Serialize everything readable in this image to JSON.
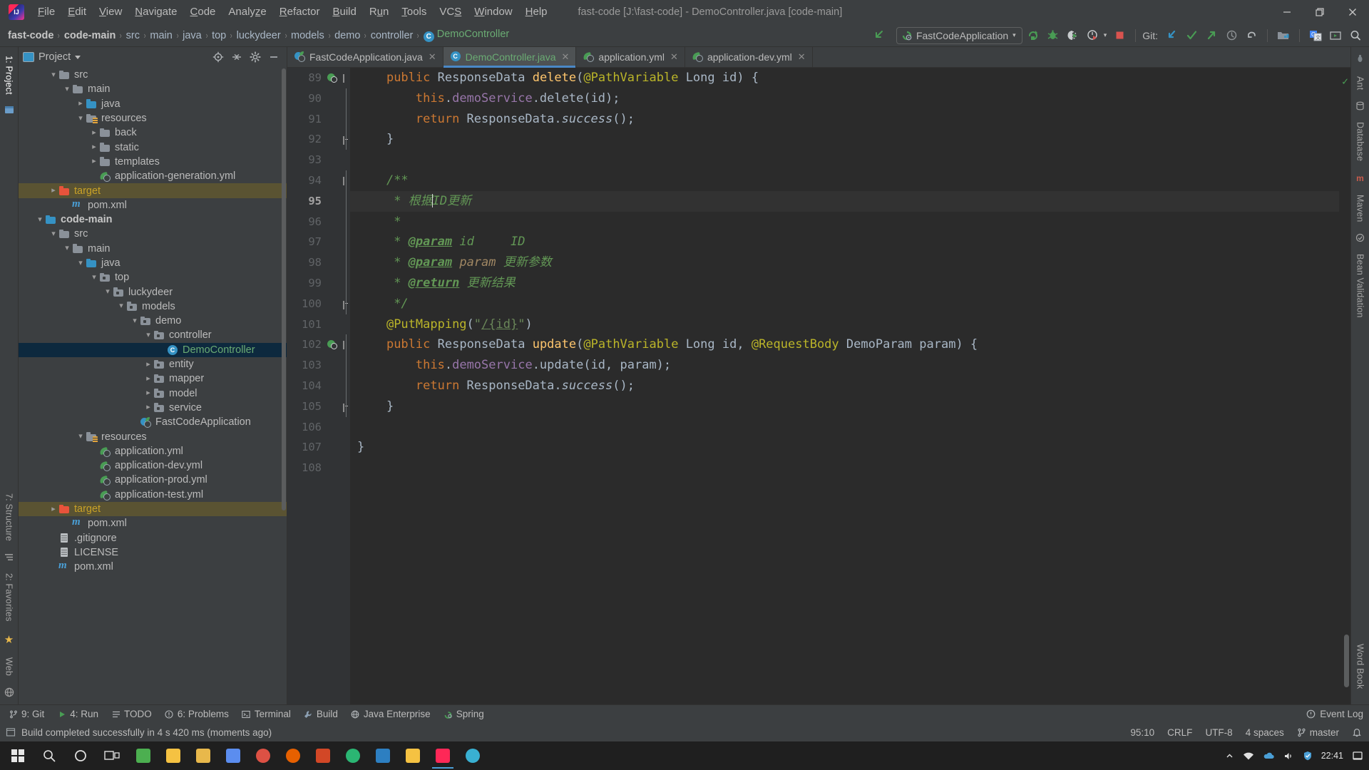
{
  "window": {
    "title": "fast-code [J:\\fast-code] - DemoController.java [code-main]",
    "minimize_label": "—",
    "maximize_label": "❐",
    "close_label": "✕"
  },
  "menubar": {
    "items": [
      {
        "label": "File",
        "mnemonic": "F"
      },
      {
        "label": "Edit",
        "mnemonic": "E"
      },
      {
        "label": "View",
        "mnemonic": "V"
      },
      {
        "label": "Navigate",
        "mnemonic": "N"
      },
      {
        "label": "Code",
        "mnemonic": "C"
      },
      {
        "label": "Analyze",
        "mnemonic": "z"
      },
      {
        "label": "Refactor",
        "mnemonic": "R"
      },
      {
        "label": "Build",
        "mnemonic": "B"
      },
      {
        "label": "Run",
        "mnemonic": "u"
      },
      {
        "label": "Tools",
        "mnemonic": "T"
      },
      {
        "label": "VCS",
        "mnemonic": "S"
      },
      {
        "label": "Window",
        "mnemonic": "W"
      },
      {
        "label": "Help",
        "mnemonic": "H"
      }
    ]
  },
  "breadcrumbs": {
    "items": [
      "fast-code",
      "code-main",
      "src",
      "main",
      "java",
      "top",
      "luckydeer",
      "models",
      "demo",
      "controller"
    ],
    "class_name": "DemoController",
    "class_icon_letter": "C",
    "separator": "›"
  },
  "toolbar": {
    "back_icon": "back-arrow-icon",
    "run_configuration": "FastCodeApplication",
    "run_config_caret": "▾",
    "run_icon": "run-icon",
    "debug_icon": "debug-icon",
    "run_coverage_icon": "run-with-coverage-icon",
    "profiler_icon": "profiler-icon",
    "profiler_caret": "▾",
    "stop_icon": "stop-icon",
    "git_label": "Git:",
    "update_project_icon": "update-project-icon",
    "commit_icon": "commit-icon",
    "push_icon": "push-icon",
    "history_icon": "history-icon",
    "rollback_icon": "rollback-icon",
    "project_structure_icon": "project-structure-icon",
    "translate_icon": "translate-icon",
    "presentation_icon": "presentation-icon",
    "search_everywhere_icon": "search-icon"
  },
  "left_strip": {
    "project_tab": "1: Project",
    "structure_tab": "7: Structure",
    "favorites_tab": "2: Favorites",
    "web_tab": "Web",
    "bottom_icons": [
      "bookmark-star-icon",
      "web-icon"
    ]
  },
  "right_strip": {
    "tabs": [
      "Ant",
      "Database",
      "Maven",
      "Bean Validation",
      "Word Book"
    ]
  },
  "project_panel": {
    "title": "Project",
    "title_caret": "▾",
    "locate_icon": "locate-in-tree-icon",
    "collapse_icon": "collapse-all-icon",
    "settings_icon": "gear-icon",
    "hide_icon": "hide-panel-icon",
    "tree": [
      {
        "label": "src",
        "indent": 2,
        "arrow": "down",
        "icon": "folder",
        "style": ""
      },
      {
        "label": "main",
        "indent": 3,
        "arrow": "down",
        "icon": "folder",
        "style": ""
      },
      {
        "label": "java",
        "indent": 4,
        "arrow": "right",
        "icon": "folder-src",
        "style": ""
      },
      {
        "label": "resources",
        "indent": 4,
        "arrow": "down",
        "icon": "folder-res",
        "style": ""
      },
      {
        "label": "back",
        "indent": 5,
        "arrow": "right",
        "icon": "folder",
        "style": ""
      },
      {
        "label": "static",
        "indent": 5,
        "arrow": "right",
        "icon": "folder",
        "style": ""
      },
      {
        "label": "templates",
        "indent": 5,
        "arrow": "right",
        "icon": "folder",
        "style": ""
      },
      {
        "label": "application-generation.yml",
        "indent": 5,
        "arrow": "none",
        "icon": "yml",
        "style": ""
      },
      {
        "label": "target",
        "indent": 2,
        "arrow": "right",
        "icon": "folder-orange",
        "style": "target"
      },
      {
        "label": "pom.xml",
        "indent": 3,
        "arrow": "none",
        "icon": "maven",
        "style": ""
      },
      {
        "label": "code-main",
        "indent": 1,
        "arrow": "down",
        "icon": "folder-src",
        "style": "bold"
      },
      {
        "label": "src",
        "indent": 2,
        "arrow": "down",
        "icon": "folder",
        "style": ""
      },
      {
        "label": "main",
        "indent": 3,
        "arrow": "down",
        "icon": "folder",
        "style": ""
      },
      {
        "label": "java",
        "indent": 4,
        "arrow": "down",
        "icon": "folder-src",
        "style": ""
      },
      {
        "label": "top",
        "indent": 5,
        "arrow": "down",
        "icon": "folder-pkg",
        "style": ""
      },
      {
        "label": "luckydeer",
        "indent": 6,
        "arrow": "down",
        "icon": "folder-pkg",
        "style": ""
      },
      {
        "label": "models",
        "indent": 7,
        "arrow": "down",
        "icon": "folder-pkg",
        "style": ""
      },
      {
        "label": "demo",
        "indent": 8,
        "arrow": "down",
        "icon": "folder-pkg",
        "style": ""
      },
      {
        "label": "controller",
        "indent": 9,
        "arrow": "down",
        "icon": "folder-pkg",
        "style": ""
      },
      {
        "label": "DemoController",
        "indent": 10,
        "arrow": "none",
        "icon": "class",
        "style": "selected"
      },
      {
        "label": "entity",
        "indent": 9,
        "arrow": "right",
        "icon": "folder-pkg",
        "style": ""
      },
      {
        "label": "mapper",
        "indent": 9,
        "arrow": "right",
        "icon": "folder-pkg",
        "style": ""
      },
      {
        "label": "model",
        "indent": 9,
        "arrow": "right",
        "icon": "folder-pkg",
        "style": ""
      },
      {
        "label": "service",
        "indent": 9,
        "arrow": "right",
        "icon": "folder-pkg",
        "style": ""
      },
      {
        "label": "FastCodeApplication",
        "indent": 8,
        "arrow": "none",
        "icon": "spring",
        "style": ""
      },
      {
        "label": "resources",
        "indent": 4,
        "arrow": "down",
        "icon": "folder-res",
        "style": ""
      },
      {
        "label": "application.yml",
        "indent": 5,
        "arrow": "none",
        "icon": "yml",
        "style": ""
      },
      {
        "label": "application-dev.yml",
        "indent": 5,
        "arrow": "none",
        "icon": "yml",
        "style": ""
      },
      {
        "label": "application-prod.yml",
        "indent": 5,
        "arrow": "none",
        "icon": "yml",
        "style": ""
      },
      {
        "label": "application-test.yml",
        "indent": 5,
        "arrow": "none",
        "icon": "yml",
        "style": ""
      },
      {
        "label": "target",
        "indent": 2,
        "arrow": "right",
        "icon": "folder-orange",
        "style": "target"
      },
      {
        "label": "pom.xml",
        "indent": 3,
        "arrow": "none",
        "icon": "maven",
        "style": ""
      },
      {
        "label": ".gitignore",
        "indent": 2,
        "arrow": "none",
        "icon": "file",
        "style": ""
      },
      {
        "label": "LICENSE",
        "indent": 2,
        "arrow": "none",
        "icon": "file",
        "style": ""
      },
      {
        "label": "pom.xml",
        "indent": 2,
        "arrow": "none",
        "icon": "maven",
        "style": ""
      }
    ]
  },
  "editor_tabs": [
    {
      "label": "FastCodeApplication.java",
      "icon": "spring-class-icon",
      "active": false,
      "close": "✕"
    },
    {
      "label": "DemoController.java",
      "icon": "class-icon",
      "active": true,
      "close": "✕"
    },
    {
      "label": "application.yml",
      "icon": "yml-icon",
      "active": false,
      "close": "✕"
    },
    {
      "label": "application-dev.yml",
      "icon": "yml-icon",
      "active": false,
      "close": "✕"
    }
  ],
  "editor": {
    "first_line_number": 89,
    "current_line": 95,
    "inspection_status": "ok-check-icon",
    "lines": [
      {
        "n": 89,
        "gutter": "run",
        "fold": "end-open",
        "html": "    <span class='kw'>public</span> <span class='type'>ResponseData</span> <span class='fn'>delete</span>(<span class='ann'>@PathVariable</span> <span class='type'>Long</span> id) {"
      },
      {
        "n": 90,
        "gutter": "",
        "fold": "line",
        "html": "        <span class='kw'>this</span>.<span class='fld'>demoService</span>.delete(id);"
      },
      {
        "n": 91,
        "gutter": "",
        "fold": "line",
        "html": "        <span class='kw'>return</span> ResponseData.<span class='italic'>success</span>();"
      },
      {
        "n": 92,
        "gutter": "",
        "fold": "end",
        "html": "    }"
      },
      {
        "n": 93,
        "gutter": "",
        "fold": "",
        "html": ""
      },
      {
        "n": 94,
        "gutter": "",
        "fold": "start",
        "html": "    <span class='cmt'>/**</span>"
      },
      {
        "n": 95,
        "gutter": "",
        "fold": "line",
        "html": "     <span class='cmt'>* 根据</span><span class='caret'></span><span class='cmt'>ID更新</span>",
        "highlight": true
      },
      {
        "n": 96,
        "gutter": "",
        "fold": "line",
        "html": "     <span class='cmt'>*</span>"
      },
      {
        "n": 97,
        "gutter": "",
        "fold": "line",
        "html": "     <span class='cmt'>* </span><span class='cmt-tag'>@param</span><span class='cmt'> id     ID</span>"
      },
      {
        "n": 98,
        "gutter": "",
        "fold": "line",
        "html": "     <span class='cmt'>* </span><span class='cmt-tag'>@param</span> <span class='cmt-pname'>param</span><span class='cmt'> 更新参数</span>"
      },
      {
        "n": 99,
        "gutter": "",
        "fold": "line",
        "html": "     <span class='cmt'>* </span><span class='cmt-tag'>@return</span><span class='cmt'> 更新结果</span>"
      },
      {
        "n": 100,
        "gutter": "",
        "fold": "end",
        "html": "     <span class='cmt'>*/</span>"
      },
      {
        "n": 101,
        "gutter": "",
        "fold": "",
        "html": "    <span class='ann'>@PutMapping</span>(<span class='str'>\"<span style='text-decoration:underline'>/{id}</span>\"</span>)"
      },
      {
        "n": 102,
        "gutter": "run",
        "fold": "start",
        "html": "    <span class='kw'>public</span> <span class='type'>ResponseData</span> <span class='fn'>update</span>(<span class='ann'>@PathVariable</span> <span class='type'>Long</span> id, <span class='ann'>@RequestBody</span> <span class='type'>DemoParam</span> param) {"
      },
      {
        "n": 103,
        "gutter": "",
        "fold": "line",
        "html": "        <span class='kw'>this</span>.<span class='fld'>demoService</span>.update(id, param);"
      },
      {
        "n": 104,
        "gutter": "",
        "fold": "line",
        "html": "        <span class='kw'>return</span> ResponseData.<span class='italic'>success</span>();"
      },
      {
        "n": 105,
        "gutter": "",
        "fold": "end",
        "html": "    }"
      },
      {
        "n": 106,
        "gutter": "",
        "fold": "",
        "html": ""
      },
      {
        "n": 107,
        "gutter": "",
        "fold": "",
        "html": "}"
      },
      {
        "n": 108,
        "gutter": "",
        "fold": "",
        "html": ""
      }
    ]
  },
  "toolwindow_bar": {
    "items": [
      {
        "label": "9: Git",
        "icon": "git-branch-icon"
      },
      {
        "label": "4: Run",
        "icon": "run-icon"
      },
      {
        "label": "TODO",
        "icon": "todo-icon"
      },
      {
        "label": "6: Problems",
        "icon": "problems-icon"
      },
      {
        "label": "Terminal",
        "icon": "terminal-icon"
      },
      {
        "label": "Build",
        "icon": "build-icon"
      },
      {
        "label": "Java Enterprise",
        "icon": "java-enterprise-icon"
      },
      {
        "label": "Spring",
        "icon": "spring-icon"
      }
    ],
    "event_log": "Event Log",
    "event_log_icon": "event-log-icon"
  },
  "statusbar": {
    "message": "Build completed successfully in 4 s 420 ms (moments ago)",
    "message_icon": "build-status-icon",
    "caret_position": "95:10",
    "line_separator": "CRLF",
    "encoding": "UTF-8",
    "indent": "4 spaces",
    "branch": "master",
    "branch_icon": "git-branch-icon"
  },
  "taskbar": {
    "start_icon": "windows-start-icon",
    "search_icon": "search-icon",
    "cortana_icon": "cortana-icon",
    "taskview_icon": "task-view-icon",
    "apps": [
      {
        "name": "wechat-icon",
        "color": "#4caf50"
      },
      {
        "name": "folder-icon",
        "color": "#f5c242"
      },
      {
        "name": "note-icon",
        "color": "#e8b84b"
      },
      {
        "name": "editor-icon",
        "color": "#5b8def"
      },
      {
        "name": "chrome-icon",
        "color": "#dd5144"
      },
      {
        "name": "firefox-icon",
        "color": "#e66000"
      },
      {
        "name": "media-icon",
        "color": "#d24726"
      },
      {
        "name": "chat-icon",
        "color": "#2bb673"
      },
      {
        "name": "vscode-icon",
        "color": "#2d7fc1"
      },
      {
        "name": "explorer-icon",
        "color": "#f5c242"
      },
      {
        "name": "intellij-icon",
        "color": "#fe2857"
      },
      {
        "name": "clock-icon",
        "color": "#39b0d2"
      }
    ],
    "tray_icons": [
      "chevron-up-icon",
      "network-icon",
      "onedrive-icon",
      "volume-icon",
      "shield-icon"
    ],
    "clock_time": "22:41",
    "notification_icon": "notifications-icon"
  }
}
